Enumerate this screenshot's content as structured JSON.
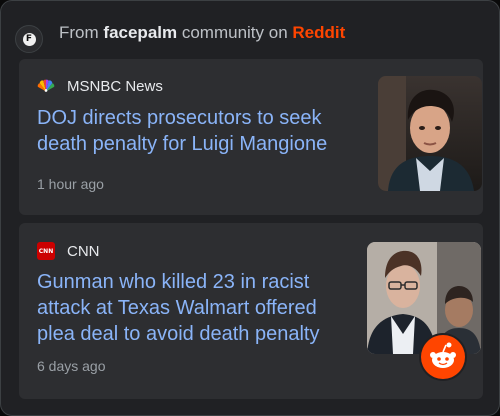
{
  "header": {
    "prefix": "From",
    "community": "facepalm",
    "middle": "community on",
    "platform": "Reddit",
    "avatar_letter": "F",
    "avatar_icon": "facepalm-community-avatar-icon"
  },
  "articles": [
    {
      "source": "MSNBC News",
      "source_icon": "msnbc-peacock-logo-icon",
      "headline": "DOJ directs prosecutors to seek death penalty for Luigi Mangione",
      "time": "1 hour ago",
      "thumbnail": "news-photo-thumbnail"
    },
    {
      "source": "CNN",
      "source_logo_text": "CNN",
      "source_icon": "cnn-logo-icon",
      "headline": "Gunman who killed 23 in racist attack at Texas Walmart offered plea deal to avoid death penalty",
      "time": "6 days ago",
      "thumbnail": "news-photo-thumbnail"
    }
  ],
  "badge": {
    "icon": "reddit-snoo-icon"
  },
  "colors": {
    "background": "#202124",
    "card": "#2d2e31",
    "headline_link": "#8ab4f8",
    "reddit_orange": "#ff4500",
    "secondary_text": "#9aa0a6"
  }
}
